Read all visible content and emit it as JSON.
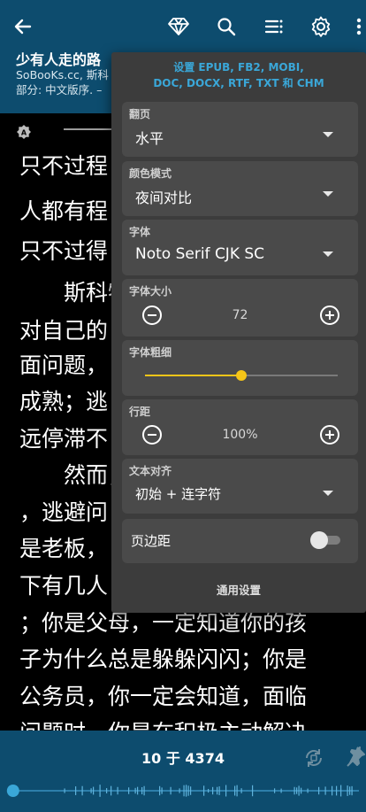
{
  "header": {
    "back_icon": "arrow-left-icon",
    "book_title": "少有人走的路",
    "meta_line_1": "SoBooKs.cc, 斯科",
    "meta_line_2": "部分: 中文版序. –",
    "actions": [
      "diamond-icon",
      "search-icon",
      "toc-list-icon",
      "gear-icon",
      "more-vert-icon"
    ]
  },
  "reader": {
    "lines": [
      "只不过程",
      "人都有程",
      "只不过得",
      "　　斯科特",
      "对自己的",
      "面问题，",
      "成熟；逃",
      "远停滞不",
      "　　然而，",
      "，逃避问",
      "是老板，",
      "下有几人",
      "；你是父母，一定知道你的孩",
      "子为什么总是躲躲闪闪；你是",
      "公务员，你一定会知道，面临",
      "问题时，你是在积极主动解决"
    ]
  },
  "settings": {
    "header_line_1": "设置 EPUB, FB2, MOBI,",
    "header_line_2": "DOC, DOCX, RTF, TXT 和 CHM",
    "paging": {
      "label": "翻页",
      "value": "水平"
    },
    "color_mode": {
      "label": "颜色模式",
      "value": "夜间对比"
    },
    "font": {
      "label": "字体",
      "value": "Noto Serif CJK SC"
    },
    "font_size": {
      "label": "字体大小",
      "value": "72"
    },
    "font_weight": {
      "label": "字体粗细",
      "level_percent": 50
    },
    "line_spacing": {
      "label": "行距",
      "value": "100%"
    },
    "text_align": {
      "label": "文本对齐",
      "value": "初始 + 连字符"
    },
    "margins": {
      "label": "页边距",
      "enabled": false
    },
    "footer": "通用设置"
  },
  "bottom": {
    "page_indicator": "10 于 4374",
    "progress_fraction": 0.002
  },
  "colors": {
    "bar": "#0d4c6e",
    "accent_blue": "#3aa7d8",
    "slider": "#f5c518",
    "panel": "#3c3c3c",
    "card": "#4a4a4a"
  }
}
